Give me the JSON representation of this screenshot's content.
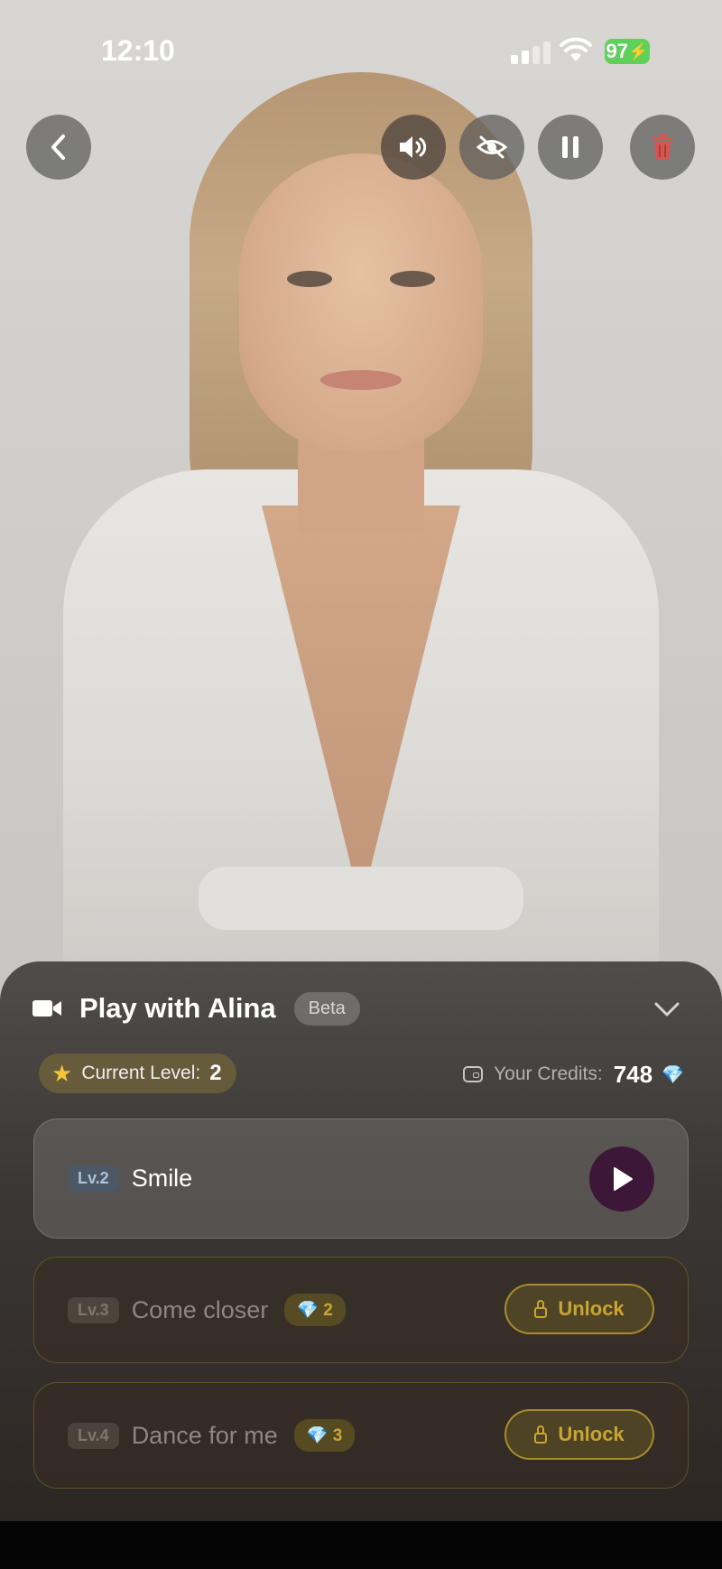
{
  "status_bar": {
    "time": "12:10",
    "battery": "97"
  },
  "controls": {
    "back_icon": "chevron-left-icon",
    "sound_icon": "speaker-icon",
    "hide_icon": "eye-slash-icon",
    "pause_icon": "pause-icon",
    "delete_icon": "trash-icon"
  },
  "sheet": {
    "title": "Play with Alina",
    "badge": "Beta",
    "level_label": "Current Level:",
    "level_value": "2",
    "credits_label": "Your Credits:",
    "credits_value": "748",
    "actions": [
      {
        "level": "Lv.2",
        "title": "Smile",
        "state": "unlocked"
      },
      {
        "level": "Lv.3",
        "title": "Come closer",
        "cost": "2",
        "button": "Unlock",
        "state": "locked"
      },
      {
        "level": "Lv.4",
        "title": "Dance for me",
        "cost": "3",
        "button": "Unlock",
        "state": "locked"
      }
    ]
  },
  "colors": {
    "accent_gold": "#c9a632",
    "play_button": "#3c1737",
    "battery_green": "#5fd15a",
    "delete_red": "#d9534f"
  }
}
